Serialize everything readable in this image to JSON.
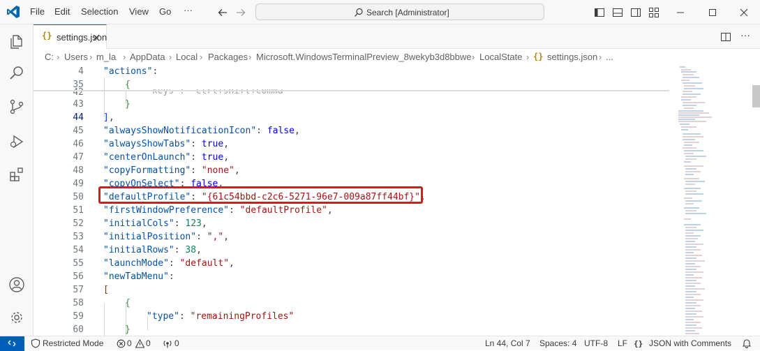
{
  "menu": [
    "File",
    "Edit",
    "Selection",
    "View",
    "Go",
    "···"
  ],
  "search": {
    "placeholder": "Search [Administrator]"
  },
  "tab": {
    "label": "settings.json"
  },
  "breadcrumb": [
    "C:",
    "Users",
    "m_la",
    "AppData",
    "Local",
    "Packages",
    "Microsoft.WindowsTerminalPreview_8wekyb3d8bbwe",
    "LocalState",
    "settings.json",
    "..."
  ],
  "editor": {
    "line_numbers": [
      "4",
      "35",
      "42",
      "43",
      "44",
      "45",
      "46",
      "47",
      "48",
      "49",
      "50",
      "51",
      "52",
      "53",
      "54",
      "55",
      "56",
      "57",
      "58",
      "59",
      "60"
    ],
    "active_line": "44"
  },
  "code": {
    "l4_key": "\"actions\"",
    "l35_brace": "{",
    "l42_text": "\"keys\": \"ctrl+shift+comma\"",
    "l43_brace": "}",
    "l44_bracket": "]",
    "l45_key": "\"alwaysShowNotificationIcon\"",
    "l45_val": "false",
    "l46_key": "\"alwaysShowTabs\"",
    "l46_val": "true",
    "l47_key": "\"centerOnLaunch\"",
    "l47_val": "true",
    "l48_key": "\"copyFormatting\"",
    "l48_val": "\"none\"",
    "l49_key": "\"copyOnSelect\"",
    "l49_val": "false",
    "l50_key": "\"defaultProfile\"",
    "l50_val": "\"{61c54bbd-c2c6-5271-96e7-009a87ff44bf}\"",
    "l51_key": "\"firstWindowPreference\"",
    "l51_val": "\"defaultProfile\"",
    "l52_key": "\"initialCols\"",
    "l52_val": "123",
    "l53_key": "\"initialPosition\"",
    "l53_val": "\",\"",
    "l54_key": "\"initialRows\"",
    "l54_val": "38",
    "l55_key": "\"launchMode\"",
    "l55_val": "\"default\"",
    "l56_key": "\"newTabMenu\"",
    "l57_bracket": "[",
    "l58_brace": "{",
    "l59_key": "\"type\"",
    "l59_val": "\"remainingProfiles\"",
    "l60_brace": "}"
  },
  "status": {
    "restricted": "Restricted Mode",
    "errors": "0",
    "warnings": "0",
    "ports": "0",
    "position": "Ln 44, Col 7",
    "spaces": "Spaces: 4",
    "encoding": "UTF-8",
    "eol": "LF",
    "language": "JSON with Comments"
  },
  "colors": {
    "accent": "#005fb8",
    "highlight_box": "#e0161e",
    "key": "#0451a5",
    "string": "#a31515",
    "keyword": "#0000ff",
    "number": "#098658"
  },
  "icons": [
    "vscode-logo-icon",
    "arrow-left-icon",
    "arrow-right-icon",
    "search-icon",
    "toggle-sidebar-icon",
    "toggle-panel-icon",
    "toggle-secondary-sidebar-icon",
    "customize-layout-icon",
    "minimize-icon",
    "maximize-icon",
    "close-icon",
    "explorer-icon",
    "search-view-icon",
    "source-control-icon",
    "run-debug-icon",
    "extensions-icon",
    "accounts-icon",
    "manage-gear-icon",
    "json-file-icon",
    "split-editor-icon",
    "more-actions-icon",
    "remote-icon",
    "shield-icon",
    "error-icon",
    "warning-icon",
    "ports-icon",
    "bell-icon"
  ]
}
